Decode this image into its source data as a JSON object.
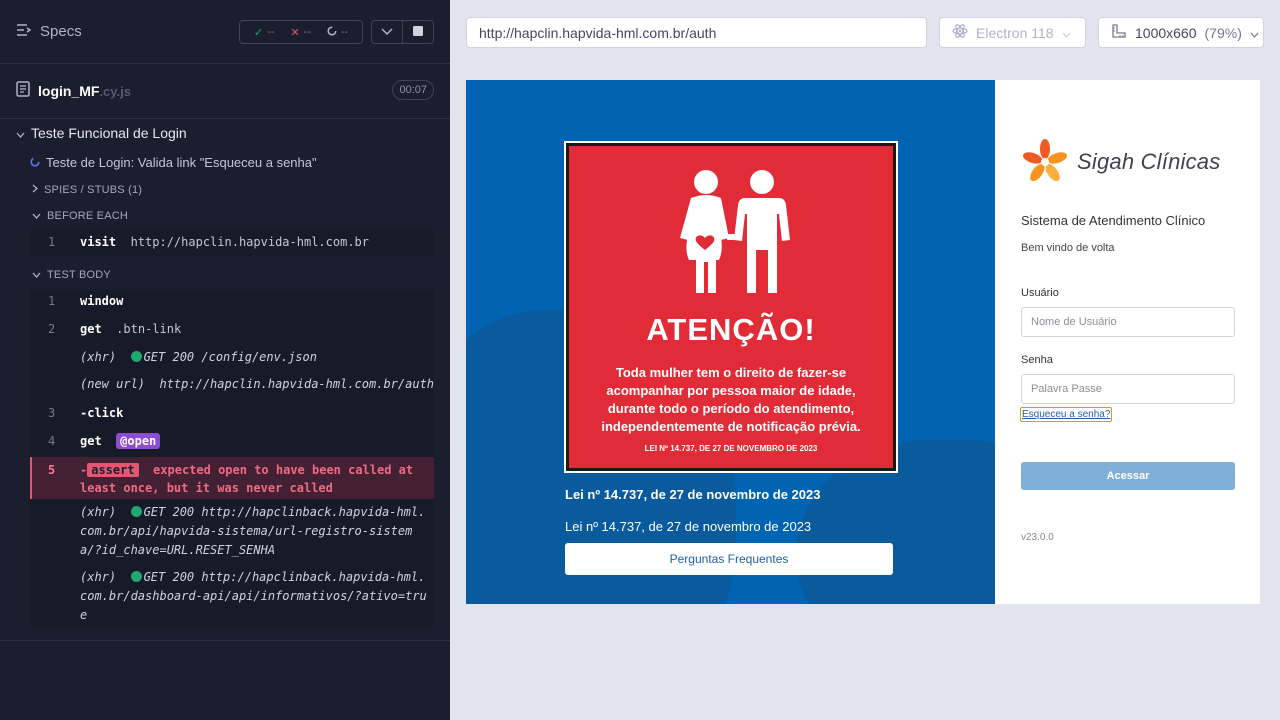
{
  "reporter": {
    "specs_label": "Specs",
    "stats": {
      "passed": "--",
      "failed": "--",
      "pending": "--"
    },
    "file": {
      "name": "login_MF",
      "ext": ".cy.js",
      "duration": "00:07"
    },
    "suite_title": "Teste Funcional de Login",
    "test_title": "Teste de Login: Valida link \"Esqueceu a senha\"",
    "spies_label": "SPIES / STUBS (1)",
    "before_each_label": "BEFORE EACH",
    "before_each_cmds": [
      {
        "num": "1",
        "name": "visit",
        "message": "http://hapclin.hapvida-hml.com.br"
      }
    ],
    "test_body_label": "TEST BODY",
    "test_body_cmds": [
      {
        "num": "1",
        "name": "window",
        "message": ""
      },
      {
        "num": "2",
        "name": "get",
        "message": ".btn-link"
      },
      {
        "num": "3",
        "name": "-click",
        "message": ""
      },
      {
        "num": "4",
        "name": "get",
        "message": ""
      }
    ],
    "xhr1": {
      "prefix": "(xhr)",
      "text": "GET 200 /config/env.json"
    },
    "new_url": {
      "prefix": "(new url)",
      "text": "http://hapclin.hapvida-hml.com.br/auth"
    },
    "alias": "@open",
    "failed_cmd": {
      "num": "5",
      "prefix": "-",
      "tag": "assert",
      "message": "expected open to have been called at least once, but it was never called"
    },
    "xhr2": {
      "prefix": "(xhr)",
      "text": "GET 200 http://hapclinback.hapvida-hml.com.br/api/hapvida-sistema/url-registro-sistema/?id_chave=URL.RESET_SENHA"
    },
    "xhr3": {
      "prefix": "(xhr)",
      "text": "GET 200 http://hapclinback.hapvida-hml.com.br/dashboard-api/api/informativos/?ativo=true"
    }
  },
  "toolbar": {
    "url": "http://hapclin.hapvida-hml.com.br/auth",
    "browser": "Electron 118",
    "viewport": "1000x660",
    "scale": "(79%)"
  },
  "app": {
    "poster": {
      "heading": "ATENÇÃO!",
      "text": "Toda mulher tem o direito de fazer-se acompanhar por pessoa maior de idade, durante todo o período do atendimento, independentemente de notificação prévia.",
      "law": "LEI Nº 14.737, DE 27 DE NOVEMBRO DE 2023"
    },
    "law_bold": "Lei nº 14.737, de 27 de novembro de 2023",
    "law_plain": "Lei nº 14.737, de 27 de novembro de 2023",
    "faq_button": "Perguntas Frequentes",
    "brand": "Sigah Clínicas",
    "system_title": "Sistema de Atendimento Clínico",
    "welcome": "Bem vindo de volta",
    "user_label": "Usuário",
    "user_placeholder": "Nome de Usuário",
    "pass_label": "Senha",
    "pass_placeholder": "Palavra Passe",
    "forgot_link": "Esqueceu a senha?",
    "login_button": "Acessar",
    "version": "v23.0.0"
  },
  "colors": {
    "reporter_bg": "#1b1e2e",
    "pass": "#1fa971",
    "fail": "#e45770",
    "alias": "#8c4cd4",
    "app_blue": "#0064b3",
    "poster_red": "#e12b36",
    "login_button": "#7faed8"
  },
  "icons": [
    "specs-list-icon",
    "check-icon",
    "x-icon",
    "pending-circle-icon",
    "chevron-down-icon",
    "stop-icon",
    "file-icon",
    "caret-down-icon",
    "caret-right-icon",
    "running-test-icon",
    "electron-icon",
    "viewport-ruler-icon",
    "flower-logo-icon"
  ]
}
